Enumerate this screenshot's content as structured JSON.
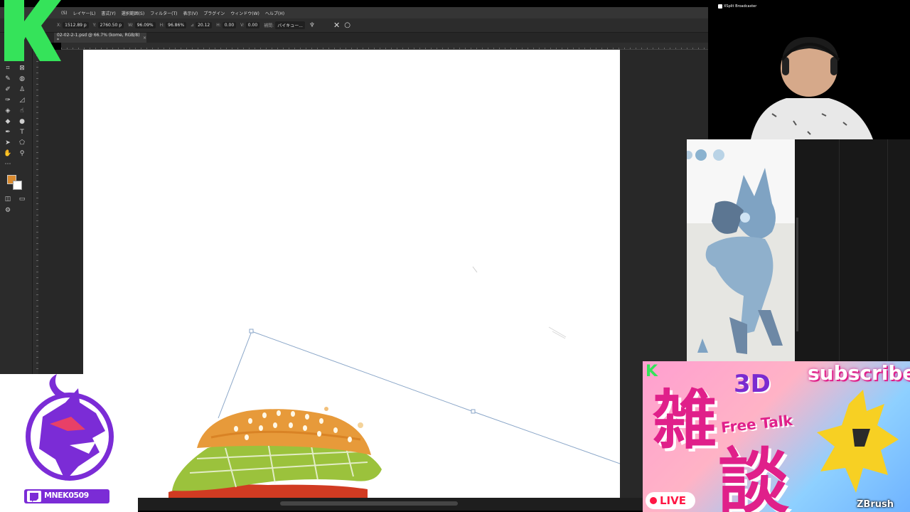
{
  "menu": [
    "(S)",
    "レイヤー(L)",
    "書式(Y)",
    "選択範囲(S)",
    "フィルター(T)",
    "表示(V)",
    "プラグイン",
    "ウィンドウ(W)",
    "ヘルプ(H)"
  ],
  "options": {
    "x_label": "X:",
    "x_value": "1512.89 p",
    "y_label": "Y:",
    "y_value": "2760.50 p",
    "w_label": "W:",
    "w_value": "96.09%",
    "h_label": "H:",
    "h_value": "96.86%",
    "angle_label": "⊿",
    "angle_value": "20.12",
    "hskew_label": "H:",
    "hskew_value": "0.00",
    "vskew_label": "V:",
    "vskew_value": "0.00",
    "interp_label": "補間:",
    "interp_value": "バイキュー..."
  },
  "document_tab": {
    "title": "02-02-2-1.psd @ 66.7% (kome, RGB/8) *",
    "close": "×"
  },
  "webcam": {
    "label": "XSplit Broadcaster"
  },
  "streamer": {
    "handle": "MNEK0509"
  },
  "thumbnail": {
    "subscribe": "subscribe",
    "k_mark": "K",
    "three_d": "3D",
    "free_talk": "Free Talk",
    "title_char1": "雑",
    "title_char2": "談",
    "live": "LIVE",
    "zbrush": "ZBrush"
  },
  "colors": {
    "foreground": "#d98a2e",
    "background": "#ffffff",
    "transform_box": "#8aa6c8",
    "k_logo": "#35e35a",
    "twitch_purple": "#7b2cd6"
  }
}
